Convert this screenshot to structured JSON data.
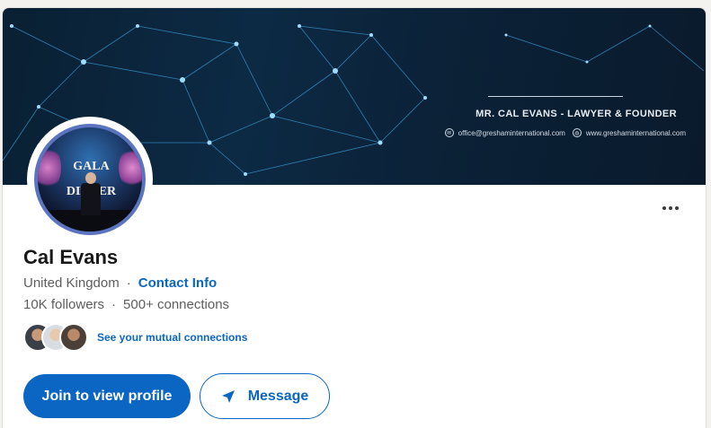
{
  "banner": {
    "title": "MR. CAL EVANS - LAWYER & FOUNDER",
    "email": "office@greshaminternational.com",
    "website": "www.greshaminternational.com"
  },
  "avatar": {
    "sign_text": "GALA DINNER"
  },
  "profile": {
    "name": "Cal Evans",
    "location": "United Kingdom",
    "separator": "·",
    "contact_info_label": "Contact Info",
    "followers": "10K followers",
    "connections": "500+ connections"
  },
  "mutual": {
    "link_label": "See your mutual connections"
  },
  "actions": {
    "join_label": "Join to view profile",
    "message_label": "Message"
  },
  "colors": {
    "accent": "#0a66c2",
    "banner_bg": "#0b2238",
    "name_text": "#191919",
    "muted_text": "#5e5e5e"
  },
  "icons": {
    "more": "more-horizontal-icon",
    "send": "send-icon",
    "email": "email-icon",
    "globe": "globe-icon"
  }
}
